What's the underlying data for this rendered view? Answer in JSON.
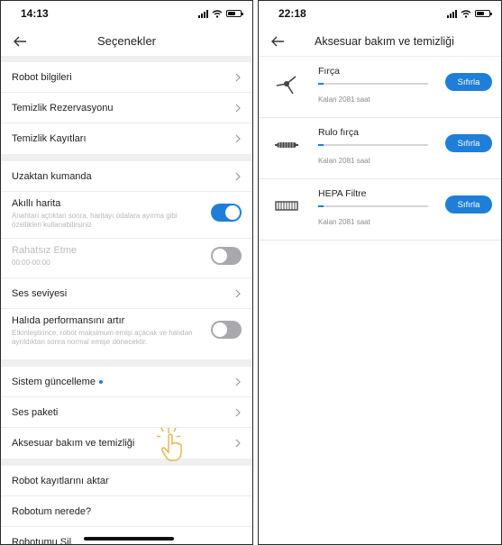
{
  "left_screen": {
    "status": {
      "time": "14:13"
    },
    "title": "Seçenekler",
    "groups": [
      {
        "rows": [
          {
            "label": "Robot bilgileri"
          },
          {
            "label": "Temizlik Rezervasyonu"
          },
          {
            "label": "Temizlik Kayıtları"
          }
        ]
      },
      {
        "rows": [
          {
            "label": "Uzaktan kumanda"
          },
          {
            "label": "Akıllı harita",
            "sub": "Anahtarı açtıktan sonra, haritayı odalara ayırma gibi özellikleri kullanabilirsiniz",
            "toggle": "on"
          },
          {
            "label": "Rahatsız Etme",
            "sub": "00:00-00:00",
            "toggle": "off"
          },
          {
            "label": "Ses seviyesi"
          },
          {
            "label": "Halıda performansını artır",
            "sub": "Etkinleştirince, robot maksimum emişi açacak ve halıdan ayrıldıktan sonra normal emişe dönecektir.",
            "toggle": "off"
          }
        ]
      },
      {
        "rows": [
          {
            "label": "Sistem güncelleme"
          },
          {
            "label": "Ses paketi"
          },
          {
            "label": "Aksesuar bakım ve temizliği"
          }
        ]
      },
      {
        "rows": [
          {
            "label": "Robot kayıtlarını aktar"
          },
          {
            "label": "Robotum nerede?"
          },
          {
            "label": "Robotumu Sil"
          }
        ]
      }
    ]
  },
  "right_screen": {
    "status": {
      "time": "22:18"
    },
    "title": "Aksesuar bakım ve temizliği",
    "items": [
      {
        "name": "Fırça",
        "remaining": "Kalan 2081 saat",
        "level": 0.05,
        "button": "Sıfırla",
        "icon": "side-brush-icon"
      },
      {
        "name": "Rulo fırça",
        "remaining": "Kalan 2081 saat",
        "level": 0.05,
        "button": "Sıfırla",
        "icon": "roller-brush-icon"
      },
      {
        "name": "HEPA Filtre",
        "remaining": "Kalan 2081 saat",
        "level": 0.05,
        "button": "Sıfırla",
        "icon": "hepa-filter-icon"
      }
    ]
  },
  "colors": {
    "accent": "#1f7fd8",
    "toggle_off": "#a9a9ad",
    "group_gap": "#efeff2"
  }
}
